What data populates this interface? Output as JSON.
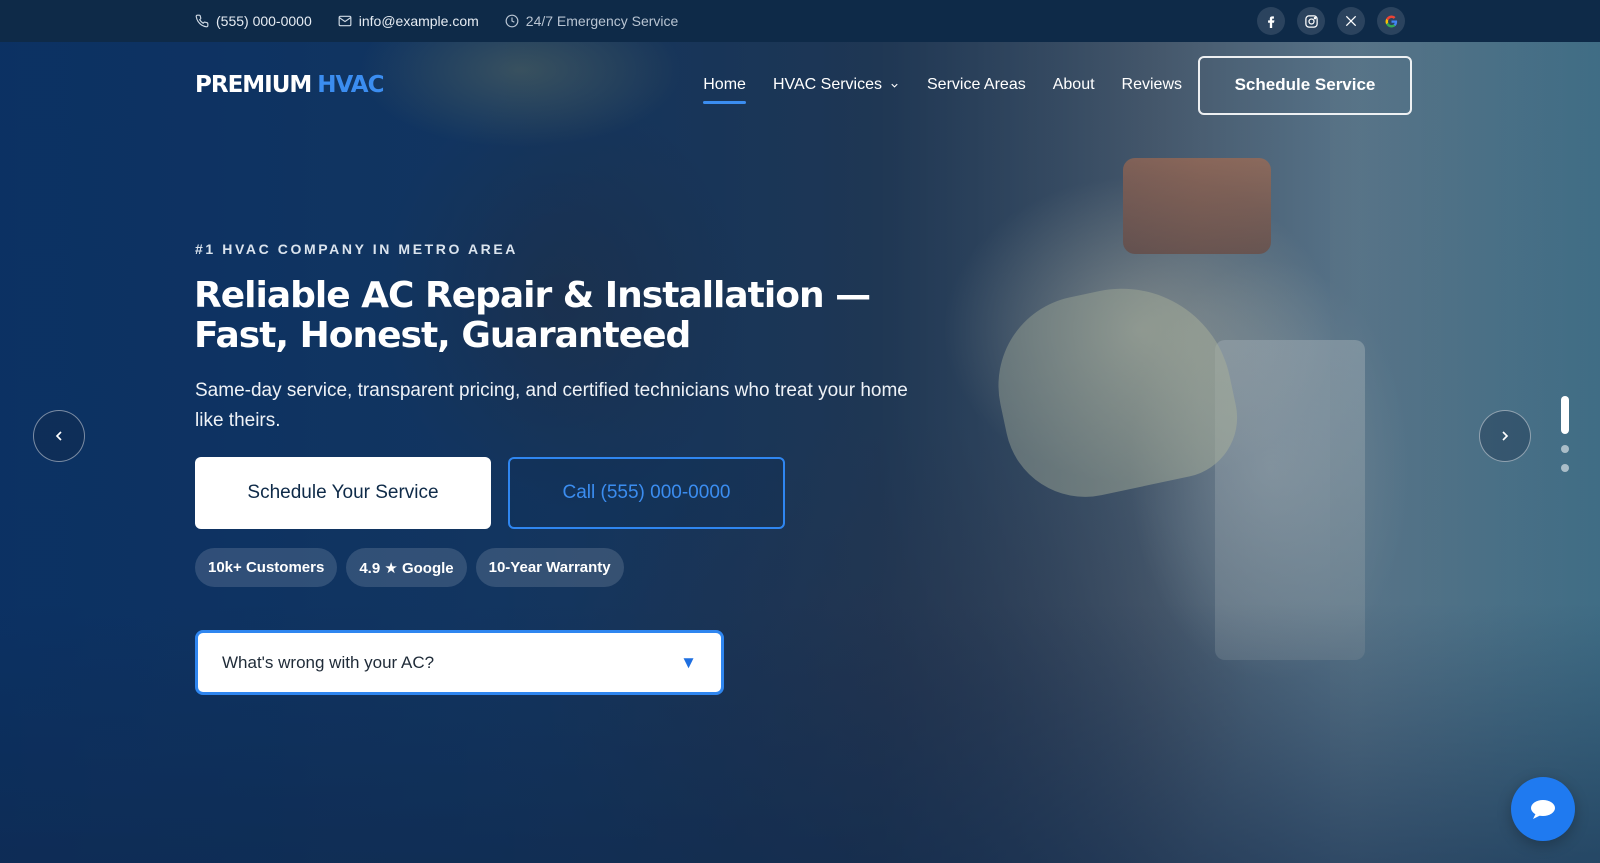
{
  "topbar": {
    "phone": "(555) 000-0000",
    "email": "info@example.com",
    "emergency": "24/7 Emergency Service",
    "socials": [
      "facebook-icon",
      "instagram-icon",
      "x-icon",
      "google-icon"
    ]
  },
  "nav": {
    "logo_primary": "PREMIUM",
    "logo_accent": "HVAC",
    "items": [
      {
        "label": "Home",
        "active": true
      },
      {
        "label": "HVAC Services",
        "dropdown": true
      },
      {
        "label": "Service Areas"
      },
      {
        "label": "About"
      },
      {
        "label": "Reviews"
      }
    ],
    "cta": "Schedule Service"
  },
  "hero": {
    "eyebrow": "#1 HVAC COMPANY IN METRO AREA",
    "headline_line1": "Reliable AC Repair & Installation —",
    "headline_line2": "Fast, Honest, Guaranteed",
    "subtitle": "Same-day service, transparent pricing, and certified technicians who treat your home like theirs.",
    "primary_button": "Schedule Your Service",
    "secondary_button": "Call (555) 000-0000",
    "badges": [
      "10k+ Customers",
      "4.9 ★ Google",
      "10-Year Warranty"
    ],
    "select_label": "What's wrong with your AC?"
  },
  "carousel": {
    "slide_count": 3,
    "active_slide": 1
  },
  "colors": {
    "accent": "#3b8df0",
    "topbar_bg": "#0e2a48",
    "chat_button": "#1f7af0"
  }
}
